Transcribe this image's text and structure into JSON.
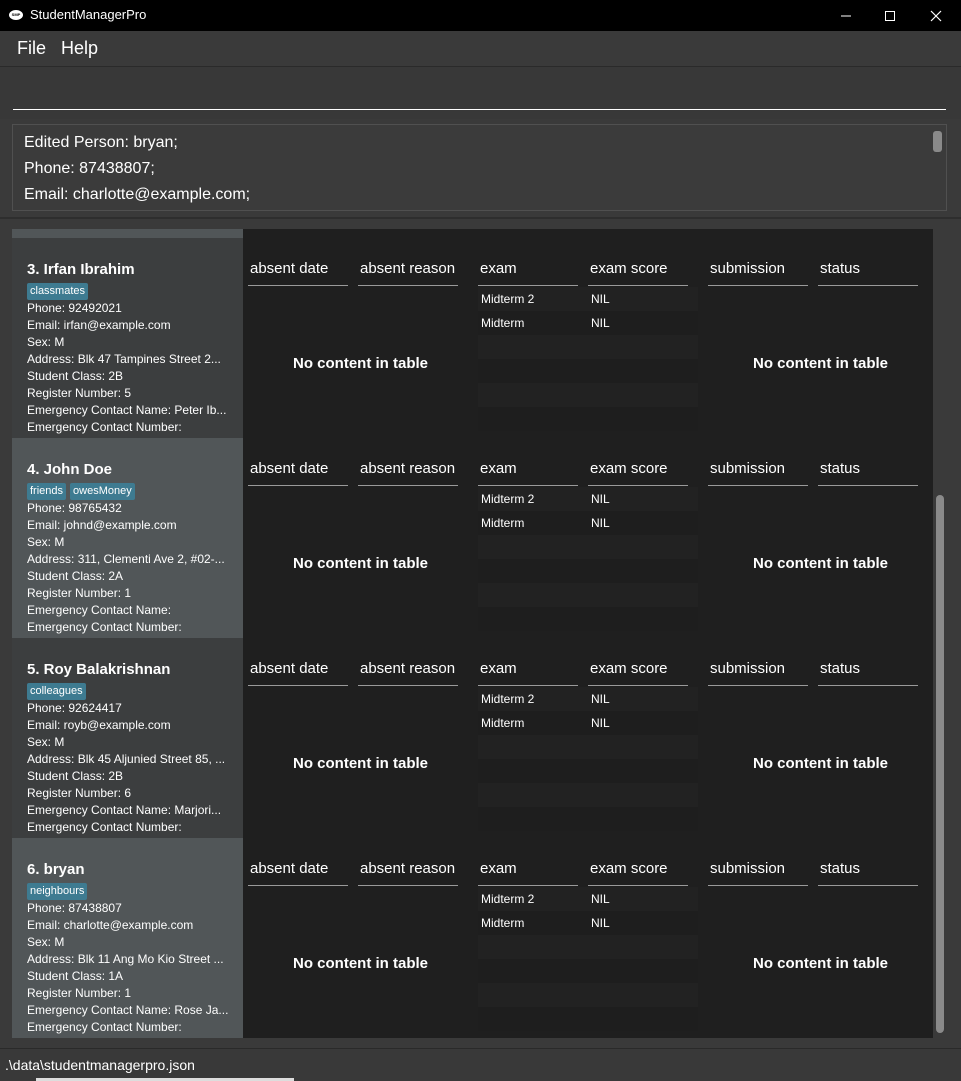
{
  "window": {
    "title": "StudentManagerPro",
    "icon_label": "SMP"
  },
  "menu": {
    "file": "File",
    "help": "Help"
  },
  "command": {
    "value": ""
  },
  "result": {
    "lines": [
      "Edited Person: bryan;",
      "Phone: 87438807;",
      "Email: charlotte@example.com;"
    ]
  },
  "table_headers": {
    "absent_date": "absent date",
    "absent_reason": "absent reason",
    "exam": "exam",
    "exam_score": "exam score",
    "submission": "submission",
    "status": "status",
    "no_content": "No content in table"
  },
  "persons": [
    {
      "name": "3. Irfan Ibrahim",
      "tags": [
        "classmates"
      ],
      "phone": "Phone: 92492021",
      "email": "Email: irfan@example.com",
      "sex": "Sex: M",
      "address": "Address: Blk 47 Tampines Street 2...",
      "student_class": "Student Class: 2B",
      "register_number": "Register Number: 5",
      "emergency_name": "Emergency Contact Name: Peter Ib...",
      "emergency_number": "Emergency Contact Number:",
      "exams": [
        {
          "exam": "Midterm 2",
          "score": "NIL"
        },
        {
          "exam": "Midterm",
          "score": "NIL"
        }
      ]
    },
    {
      "name": "4. John Doe",
      "tags": [
        "friends",
        "owesMoney"
      ],
      "phone": "Phone: 98765432",
      "email": "Email: johnd@example.com",
      "sex": "Sex: M",
      "address": "Address: 311, Clementi Ave 2, #02-...",
      "student_class": "Student Class: 2A",
      "register_number": "Register Number: 1",
      "emergency_name": "Emergency Contact Name:",
      "emergency_number": "Emergency Contact Number:",
      "exams": [
        {
          "exam": "Midterm 2",
          "score": "NIL"
        },
        {
          "exam": "Midterm",
          "score": "NIL"
        }
      ]
    },
    {
      "name": "5. Roy Balakrishnan",
      "tags": [
        "colleagues"
      ],
      "phone": "Phone: 92624417",
      "email": "Email: royb@example.com",
      "sex": "Sex: M",
      "address": "Address: Blk 45 Aljunied Street 85, ...",
      "student_class": "Student Class: 2B",
      "register_number": "Register Number: 6",
      "emergency_name": "Emergency Contact Name: Marjori...",
      "emergency_number": "Emergency Contact Number:",
      "exams": [
        {
          "exam": "Midterm 2",
          "score": "NIL"
        },
        {
          "exam": "Midterm",
          "score": "NIL"
        }
      ]
    },
    {
      "name": "6. bryan",
      "tags": [
        "neighbours"
      ],
      "phone": "Phone: 87438807",
      "email": "Email: charlotte@example.com",
      "sex": "Sex: M",
      "address": "Address: Blk 11 Ang Mo Kio Street ...",
      "student_class": "Student Class: 1A",
      "register_number": "Register Number: 1",
      "emergency_name": "Emergency Contact Name: Rose Ja...",
      "emergency_number": "Emergency Contact Number:",
      "exams": [
        {
          "exam": "Midterm 2",
          "score": "NIL"
        },
        {
          "exam": "Midterm",
          "score": "NIL"
        }
      ]
    }
  ],
  "status": {
    "file_path": ".\\data\\studentmanagerpro.json"
  },
  "colors": {
    "background": "#3a3a3a",
    "card_dark": "#3c3e3f",
    "card_light": "#515658",
    "tag": "#3e7b91",
    "table_bg": "#1f1f1f"
  }
}
